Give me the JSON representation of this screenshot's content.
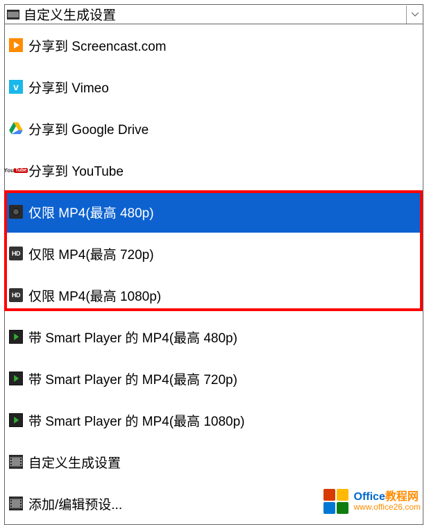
{
  "dropdown": {
    "selected_label": "自定义生成设置"
  },
  "options": [
    {
      "icon": "screencast",
      "label": "分享到 Screencast.com",
      "selected": false
    },
    {
      "icon": "vimeo",
      "label": "分享到 Vimeo",
      "selected": false
    },
    {
      "icon": "drive",
      "label": "分享到 Google Drive",
      "selected": false
    },
    {
      "icon": "youtube",
      "label": "分享到 YouTube",
      "selected": false
    },
    {
      "icon": "camera",
      "label": "仅限 MP4(最高 480p)",
      "selected": true
    },
    {
      "icon": "hd",
      "label": "仅限 MP4(最高 720p)",
      "selected": false
    },
    {
      "icon": "hd",
      "label": "仅限 MP4(最高 1080p)",
      "selected": false
    },
    {
      "icon": "player",
      "label": "带 Smart Player 的 MP4(最高 480p)",
      "selected": false
    },
    {
      "icon": "player",
      "label": "带 Smart Player 的 MP4(最高 720p)",
      "selected": false
    },
    {
      "icon": "player",
      "label": "带 Smart Player 的 MP4(最高 1080p)",
      "selected": false
    },
    {
      "icon": "film",
      "label": "自定义生成设置",
      "selected": false
    },
    {
      "icon": "film",
      "label": "添加/编辑预设...",
      "selected": false
    }
  ],
  "watermark": {
    "title_part1": "Office",
    "title_part2": "教程网",
    "url": "www.office26.com"
  },
  "icon_text": {
    "vimeo": "v",
    "hd": "HD",
    "youtube_you": "You",
    "youtube_tube": "Tube"
  }
}
